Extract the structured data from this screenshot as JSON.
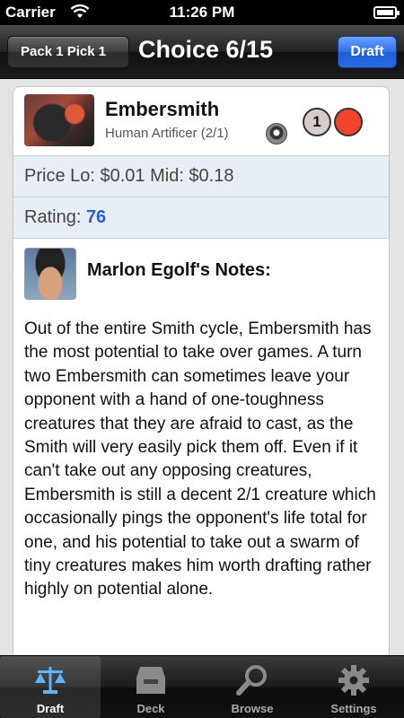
{
  "status_bar": {
    "carrier": "Carrier",
    "time": "11:26 PM",
    "battery_level": 0.95
  },
  "nav": {
    "back_label": "Pack 1 Pick 1",
    "title": "Choice 6/15",
    "action_label": "Draft"
  },
  "card": {
    "name": "Embersmith",
    "type_line": "Human Artificer (2/1)",
    "set_icon": "set-symbol-icon",
    "mana_cost": {
      "generic": "1",
      "colored": [
        "red"
      ]
    },
    "colors": {
      "red_mana": "#f2442c",
      "generic_mana": "#d6cdca"
    }
  },
  "price": {
    "text": "Price Lo: $0.01 Mid: $0.18"
  },
  "rating": {
    "label": "Rating:",
    "value": "76"
  },
  "notes": {
    "author_title": "Marlon Egolf's Notes:",
    "body": "Out of the entire Smith cycle, Embersmith has the most potential to take over games. A turn two Embersmith can sometimes leave your opponent with a hand of one-toughness creatures that they are afraid to cast, as the Smith will very easily pick them off. Even if it can't take out any opposing creatures, Embersmith is still a decent 2/1 creature which occasionally pings the opponent's life total for one, and his potential to take out a swarm of tiny creatures makes him worth drafting rather highly on potential alone."
  },
  "tabs": [
    {
      "label": "Draft",
      "icon": "scales-icon",
      "active": true
    },
    {
      "label": "Deck",
      "icon": "deck-box-icon",
      "active": false
    },
    {
      "label": "Browse",
      "icon": "magnifier-icon",
      "active": false
    },
    {
      "label": "Settings",
      "icon": "gear-icon",
      "active": false
    }
  ],
  "accent_color": "#2a5fcf"
}
